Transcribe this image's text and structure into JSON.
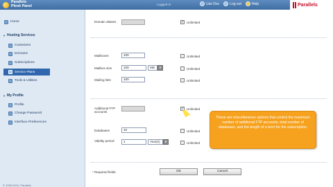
{
  "header": {
    "brand_line1": "Parallels",
    "brand_line2": "Plesk Panel",
    "user_label": "Logged in",
    "links": [
      {
        "label": "Use Doc",
        "icon": "doc-icon"
      },
      {
        "label": "Log out",
        "icon": "logout-icon"
      },
      {
        "label": "Help",
        "icon": "help-icon"
      }
    ],
    "vendor_logo": "Parallels"
  },
  "sidebar": {
    "home": "Home",
    "section_hosting": "Hosting Services",
    "hosting_items": [
      "Customers",
      "Domains",
      "Subscriptions",
      "Service Plans",
      "Tools & Utilities"
    ],
    "selected": "Service Plans",
    "section_profile": "My Profile",
    "profile_items": [
      "Profile",
      "Change Password",
      "Interface Preferences"
    ],
    "copyright": "© 1999-2010, Parallels"
  },
  "form": {
    "domain_aliases": {
      "label": "Domain aliases",
      "value": "",
      "unlimited_label": "Unlimited",
      "unlimited_checked": true
    },
    "mailboxes": {
      "label": "Mailboxes",
      "value": "100",
      "unlimited_label": "Unlimited",
      "unlimited_checked": false
    },
    "mailbox_size": {
      "label": "Mailbox size",
      "value": "100",
      "unit": "MB",
      "unlimited_label": "Unlimited",
      "unlimited_checked": false
    },
    "mailing_lists": {
      "label": "Mailing lists",
      "value": "100",
      "unlimited_label": "Unlimited",
      "unlimited_checked": false
    },
    "ftp_accounts": {
      "label": "Additional FTP accounts",
      "value": "",
      "unlimited_label": "Unlimited",
      "unlimited_checked": true
    },
    "databases": {
      "label": "Databases",
      "value": "10",
      "unlimited_label": "Unlimited",
      "unlimited_checked": false
    },
    "validity_period": {
      "label": "Validity period",
      "value": "1",
      "unit": "Year(s)",
      "unlimited_label": "Unlimited",
      "unlimited_checked": false
    },
    "required_note": "* Required fields",
    "ok_label": "OK",
    "cancel_label": "Cancel"
  },
  "tooltip": {
    "text": "These are miscellaneous options that control the maximum number of additional FTP accounts, total number of databases, and the length of a term for the subscription."
  },
  "colors": {
    "header": "#3f6ea3",
    "selected_nav": "#2f66ad",
    "tooltip": "#f6a21e",
    "vendor": "#c8102e"
  }
}
